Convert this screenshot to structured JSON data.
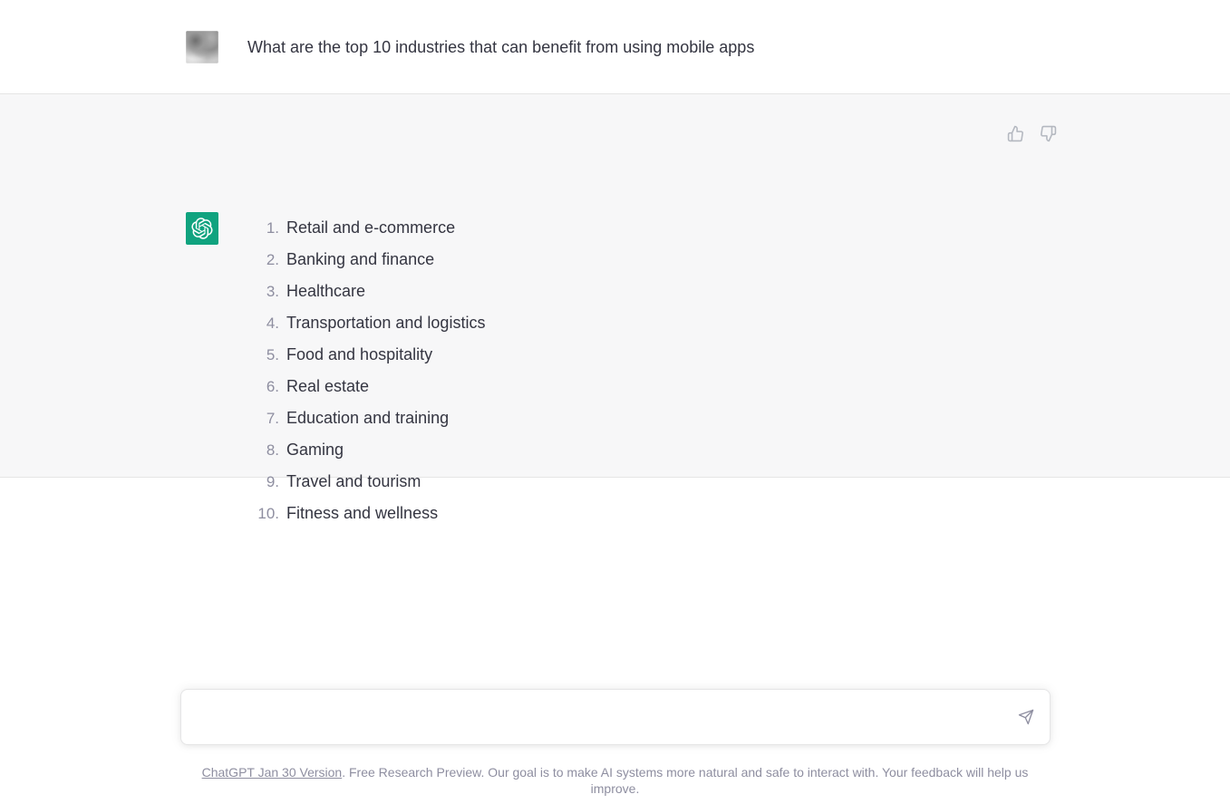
{
  "conversation": {
    "user_message": {
      "avatar_icon": "user-photo-avatar",
      "text": "What are the top 10 industries that can benefit from using mobile apps"
    },
    "assistant_message": {
      "avatar_icon": "chatgpt-logo-icon",
      "list": [
        {
          "number": "1.",
          "text": "Retail and e-commerce"
        },
        {
          "number": "2.",
          "text": "Banking and finance"
        },
        {
          "number": "3.",
          "text": "Healthcare"
        },
        {
          "number": "4.",
          "text": "Transportation and logistics"
        },
        {
          "number": "5.",
          "text": "Food and hospitality"
        },
        {
          "number": "6.",
          "text": "Real estate"
        },
        {
          "number": "7.",
          "text": "Education and training"
        },
        {
          "number": "8.",
          "text": "Gaming"
        },
        {
          "number": "9.",
          "text": "Travel and tourism"
        },
        {
          "number": "10.",
          "text": "Fitness and wellness"
        }
      ],
      "feedback": {
        "thumbs_up_icon": "thumbs-up-icon",
        "thumbs_down_icon": "thumbs-down-icon"
      }
    }
  },
  "composer": {
    "value": "",
    "placeholder": "",
    "send_icon": "send-paper-plane-icon"
  },
  "footer": {
    "link_text": "ChatGPT Jan 30 Version",
    "rest_text": ". Free Research Preview. Our goal is to make AI systems more natural and safe to interact with. Your feedback will help us improve."
  },
  "colors": {
    "brand_green": "#10a37f",
    "assistant_row_bg": "#f7f7f8",
    "user_row_bg": "#ffffff",
    "text": "#343541",
    "muted_text": "#8e8ea0"
  }
}
